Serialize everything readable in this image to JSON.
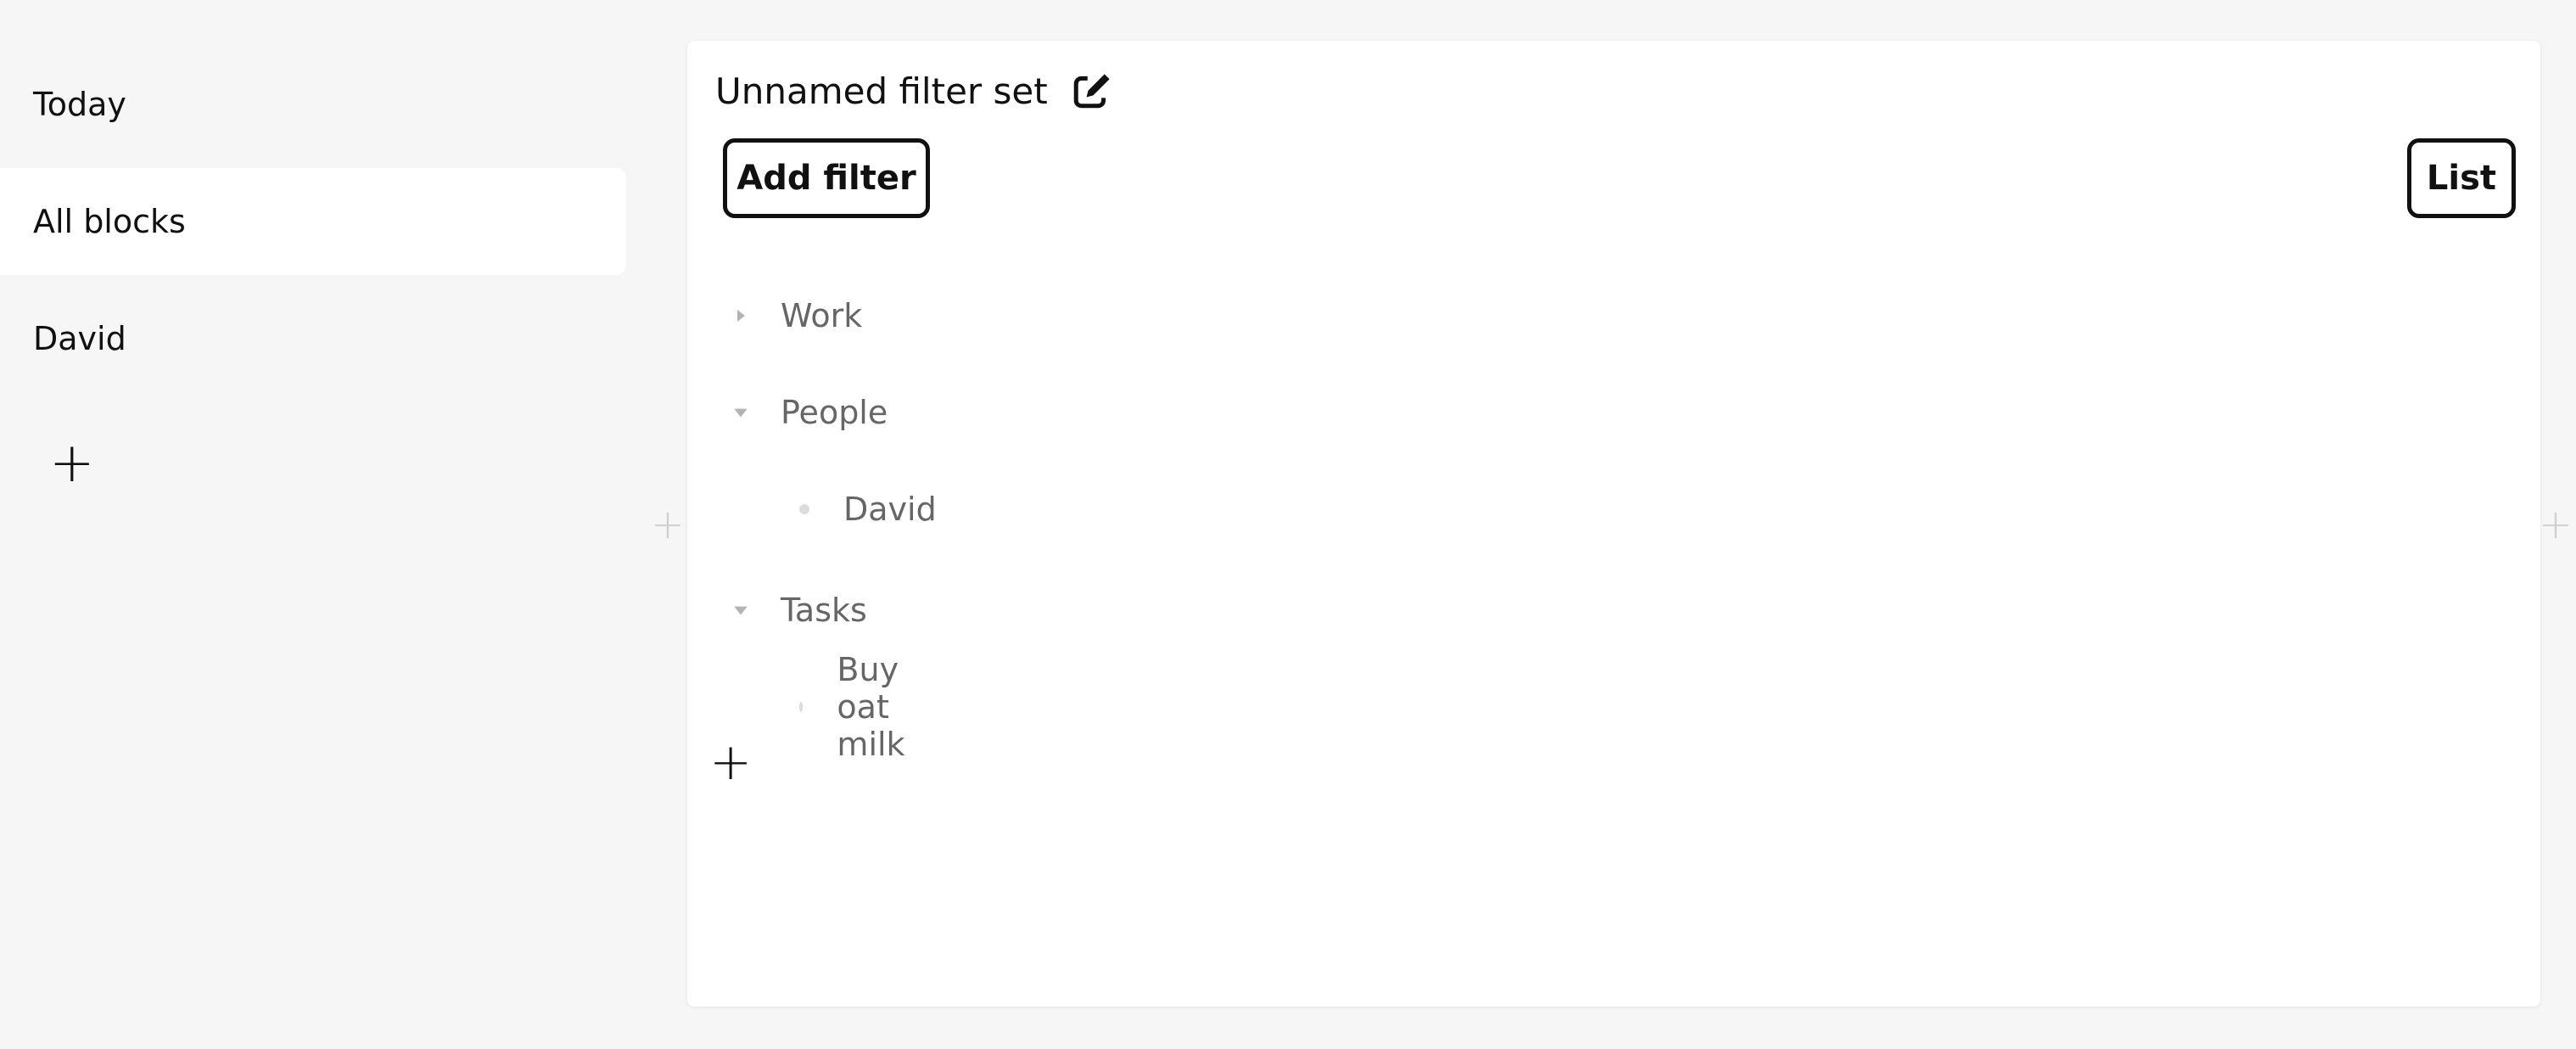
{
  "sidebar": {
    "items": [
      {
        "label": "Today"
      },
      {
        "label": "All blocks"
      },
      {
        "label": "David"
      }
    ],
    "add_icon": "plus-icon"
  },
  "panel": {
    "title": "Unnamed filter set",
    "edit_icon": "edit-icon",
    "add_filter_label": "Add filter",
    "view_label": "List",
    "tree": [
      {
        "label": "Work",
        "expanded": false
      },
      {
        "label": "People",
        "expanded": true
      },
      {
        "label": "David"
      },
      {
        "label": "Tasks",
        "expanded": true
      },
      {
        "label": "Buy oat milk"
      }
    ],
    "add_icon": "plus-icon"
  },
  "colors": {
    "background": "#f6f6f6",
    "panel": "#ffffff",
    "text": "#111111",
    "muted_text": "#666666",
    "caret": "#b3b3b3",
    "side_plus": "#cfcfcf"
  }
}
